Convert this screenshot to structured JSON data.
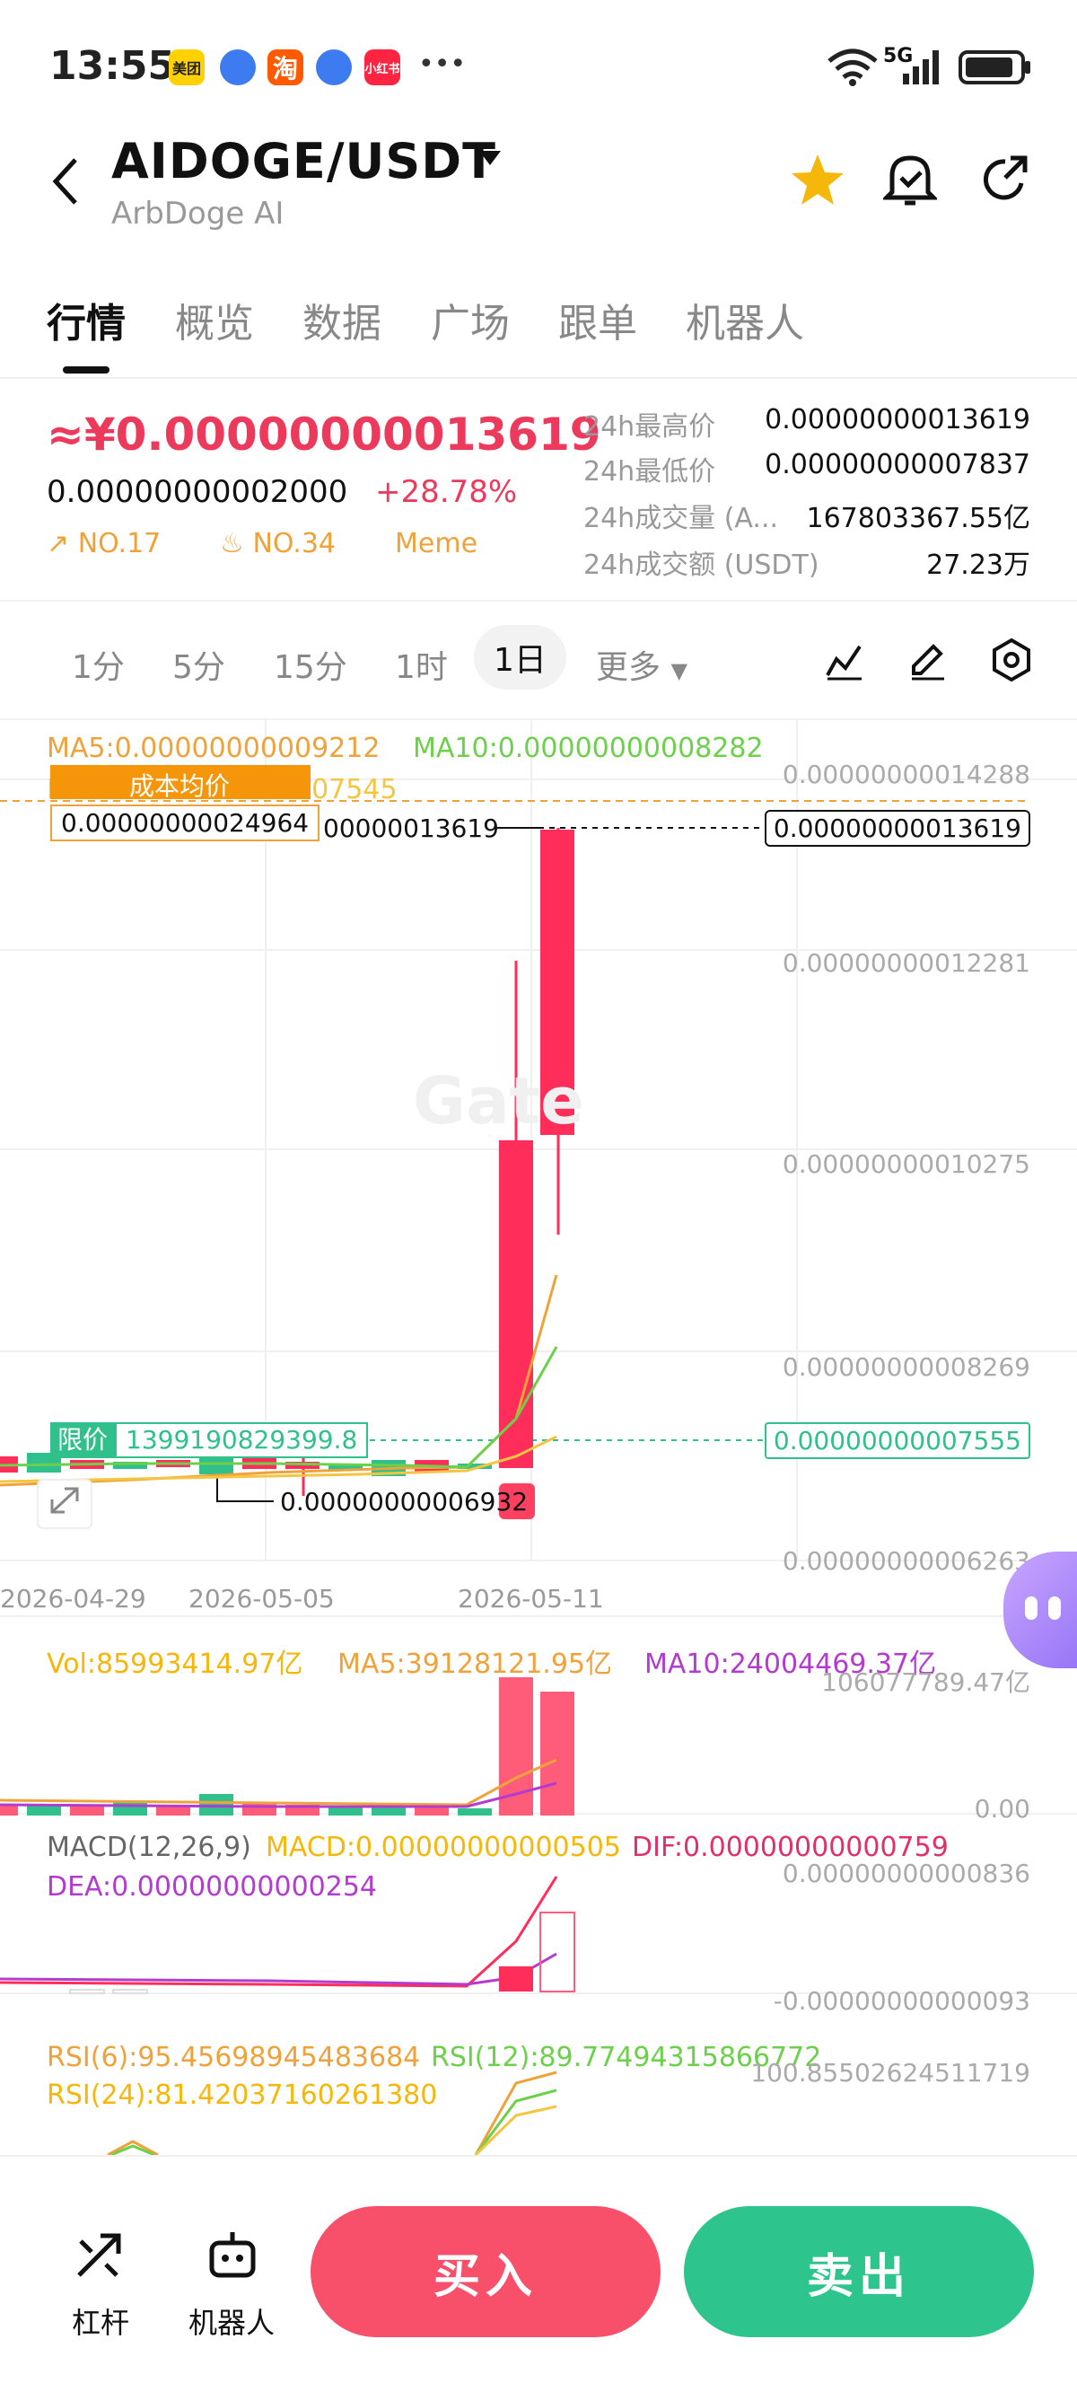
{
  "status": {
    "time": "13:55",
    "apps": [
      "美团",
      "淘",
      "小红书"
    ],
    "network": "5G"
  },
  "header": {
    "pair": "AIDOGE/USDT",
    "name": "ArbDoge AI"
  },
  "tabs": [
    "行情",
    "概览",
    "数据",
    "广场",
    "跟单",
    "机器人"
  ],
  "price": {
    "main": "≈¥0.00000000013619",
    "last": "0.00000000002000",
    "change": "+28.78%",
    "rank1": "NO.17",
    "rank2": "NO.34",
    "tag": "Meme"
  },
  "stats": [
    {
      "label": "24h最高价",
      "value": "0.00000000013619"
    },
    {
      "label": "24h最低价",
      "value": "0.00000000007837"
    },
    {
      "label": "24h成交量 (A...",
      "value": "167803367.55亿"
    },
    {
      "label": "24h成交额 (USDT)",
      "value": "27.23万"
    }
  ],
  "periods": [
    "1分",
    "5分",
    "15分",
    "1时",
    "1日",
    "更多"
  ],
  "main_chart": {
    "ma5": "MA5:0.00000000009212",
    "ma10": "MA10:0.00000000008282",
    "ma30": "MA30:0.00000000007545",
    "cost_avg_label": "成本均价",
    "cost_avg_value": "0.00000000024964",
    "high_marker": "0.00000000013619",
    "high_marker_partial": "00000013619",
    "low_marker": "0.00000000006932",
    "limit_label": "限价",
    "limit_value": "1399190829399.8",
    "limit_price": "0.00000000007555",
    "axis": [
      "0.00000000014288",
      "0.00000000012281",
      "0.00000000010275",
      "0.00000000008269",
      "0.00000000006263"
    ],
    "dates": [
      "2026-04-29",
      "2026-05-05",
      "2026-05-11"
    ],
    "watermark": "Gate"
  },
  "volume": {
    "vol": "Vol:85993414.97亿",
    "ma5": "MA5:39128121.95亿",
    "ma10": "MA10:24004469.37亿",
    "axis_top": "106077789.47亿",
    "axis_bottom": "0.00"
  },
  "macd": {
    "title": "MACD(12,26,9)",
    "macd": "MACD:0.00000000000505",
    "dif": "DIF:0.00000000000759",
    "dea": "DEA:0.00000000000254",
    "axis_top": "0.00000000000836",
    "axis_bottom": "-0.00000000000093"
  },
  "rsi": {
    "rsi6": "RSI(6):95.45698945483684",
    "rsi12": "RSI(12):89.77494315866772",
    "rsi24": "RSI(24):81.42037160261380",
    "axis_top": "100.85502624511719"
  },
  "bottom": {
    "leverage": "杠杆",
    "bot": "机器人",
    "buy": "买入",
    "sell": "卖出"
  },
  "colors": {
    "up": "#ff2d5a",
    "down": "#2fc08c",
    "ma5": "#f0a23a",
    "ma10": "#6cd04a",
    "ma30": "#f5c542",
    "purple": "#b33bd0"
  }
}
